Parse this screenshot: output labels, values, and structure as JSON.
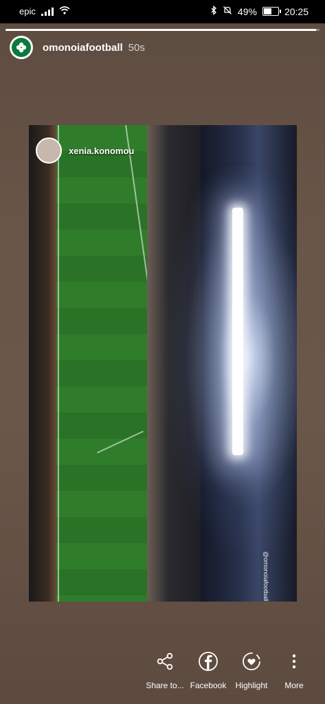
{
  "status_bar": {
    "carrier": "epic",
    "battery": "49%",
    "time": "20:25"
  },
  "story": {
    "progress_fraction": 0.99
  },
  "header": {
    "username": "omonoiafootball",
    "age": "50s"
  },
  "media": {
    "credit_username": "xenia.konomou",
    "watermark": "@omonoiafootball"
  },
  "actions": {
    "share": "Share to...",
    "facebook": "Facebook",
    "highlight": "Highlight",
    "more": "More"
  }
}
